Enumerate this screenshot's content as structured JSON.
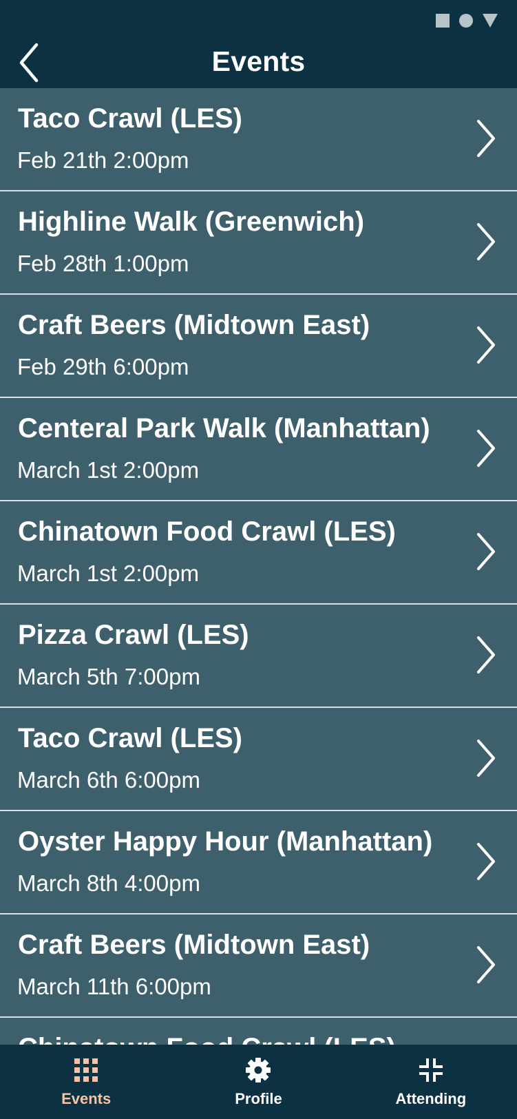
{
  "header": {
    "title": "Events",
    "back_icon": "chevron-left-icon"
  },
  "events": [
    {
      "title": "Taco Crawl (LES)",
      "date": "Feb 21th 2:00pm"
    },
    {
      "title": "Highline Walk (Greenwich)",
      "date": "Feb 28th 1:00pm"
    },
    {
      "title": "Craft Beers (Midtown East)",
      "date": "Feb 29th 6:00pm"
    },
    {
      "title": "Centeral Park Walk (Manhattan)",
      "date": "March 1st 2:00pm"
    },
    {
      "title": "Chinatown Food Crawl (LES)",
      "date": "March 1st 2:00pm"
    },
    {
      "title": "Pizza Crawl (LES)",
      "date": "March 5th 7:00pm"
    },
    {
      "title": "Taco Crawl (LES)",
      "date": "March 6th 6:00pm"
    },
    {
      "title": "Oyster Happy Hour (Manhattan)",
      "date": "March 8th 4:00pm"
    },
    {
      "title": "Craft Beers (Midtown East)",
      "date": "March 11th 6:00pm"
    },
    {
      "title": "Chinatown Food Crawl (LES)",
      "date": ""
    }
  ],
  "nav": {
    "events_label": "Events",
    "profile_label": "Profile",
    "attending_label": "Attending",
    "active": "events"
  },
  "colors": {
    "header_bg": "#0b3142",
    "list_bg": "#3e5f6c",
    "divider": "#d9dfe2",
    "accent": "#f6c4a2",
    "text": "#ffffff"
  }
}
